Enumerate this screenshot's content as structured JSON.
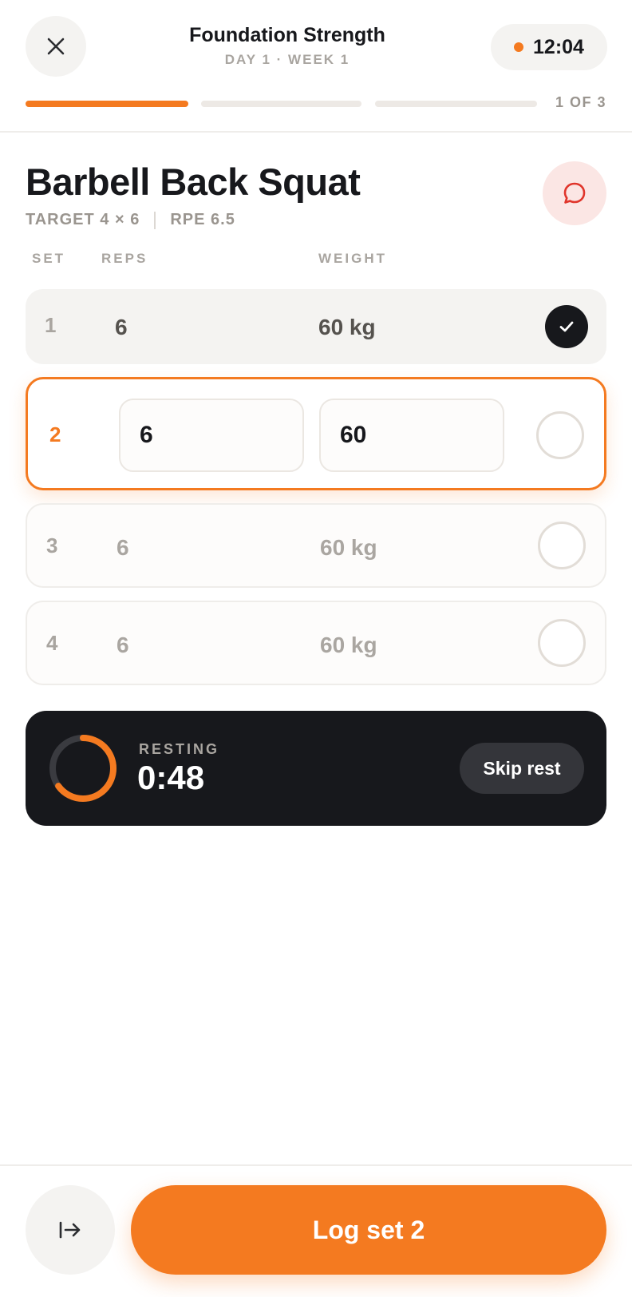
{
  "header": {
    "workout_title": "Foundation Strength",
    "workout_sub": "DAY 1 · WEEK 1",
    "elapsed": "12:04",
    "progress_label": "1 OF 3",
    "progress_done_segments": 1,
    "progress_total_segments": 3
  },
  "exercise": {
    "name": "Barbell Back Squat",
    "target": "TARGET 4 × 6",
    "rpe": "RPE 6.5"
  },
  "columns": {
    "set": "SET",
    "reps": "REPS",
    "weight": "WEIGHT"
  },
  "sets": [
    {
      "num": "1",
      "reps": "6",
      "weight": "60 kg",
      "state": "done"
    },
    {
      "num": "2",
      "reps": "6",
      "weight": "60",
      "state": "active"
    },
    {
      "num": "3",
      "reps": "6",
      "weight": "60 kg",
      "state": "upcoming"
    },
    {
      "num": "4",
      "reps": "6",
      "weight": "60 kg",
      "state": "upcoming"
    }
  ],
  "rest": {
    "label": "RESTING",
    "time": "0:48",
    "skip_label": "Skip rest",
    "progress": 0.65
  },
  "footer": {
    "log_label": "Log set 2"
  },
  "colors": {
    "accent": "#f47a20",
    "dark": "#17181c",
    "chat_bg": "#fbe6e4",
    "chat_icon": "#e0352b"
  },
  "icons": {
    "close": "close-icon",
    "chat": "chat-bubble-icon",
    "check": "check-icon",
    "next": "skip-to-end-icon"
  }
}
